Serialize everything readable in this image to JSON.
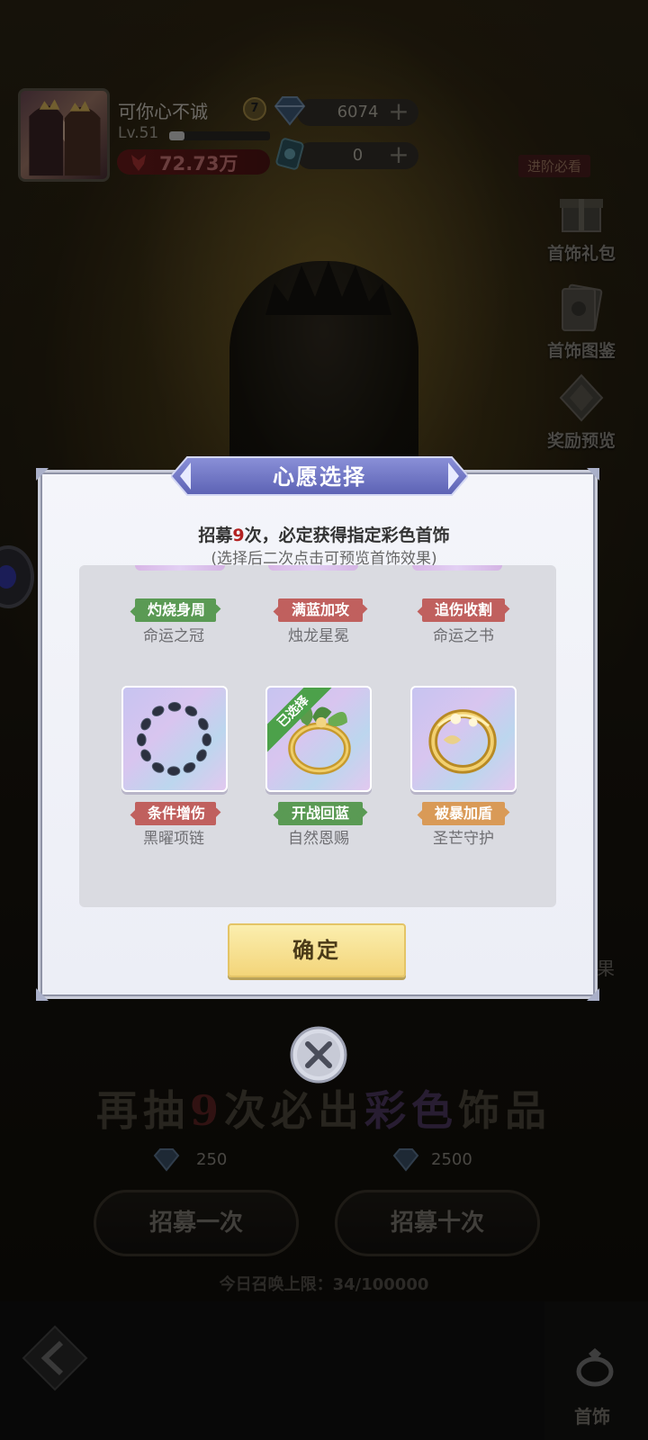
{
  "player": {
    "name": "可你心不诚",
    "level": "Lv.51",
    "level_progress": 0.15,
    "vip": "7",
    "power": "72.73万"
  },
  "currency": {
    "diamond": "6074",
    "ticket": "0",
    "plus": "+"
  },
  "side_menu": {
    "tag": "进阶必看",
    "items": [
      "首饰礼包",
      "首饰图鉴",
      "奖励预览"
    ]
  },
  "dialog": {
    "title": "心愿选择",
    "line1_prefix": "招募",
    "line1_count": "9",
    "line1_suffix": "次，必定获得指定彩色首饰",
    "line2": "(选择后二次点击可预览首饰效果)",
    "row1": [
      {
        "tag": "灼烧身周",
        "name": "命运之冠",
        "tag_color": "green"
      },
      {
        "tag": "满蓝加攻",
        "name": "烛龙星冕",
        "tag_color": "red"
      },
      {
        "tag": "追伤收割",
        "name": "命运之书",
        "tag_color": "red"
      }
    ],
    "row2": [
      {
        "tag": "条件增伤",
        "name": "黑曜项链",
        "tag_color": "red",
        "icon": "necklace-icon"
      },
      {
        "tag": "开战回蓝",
        "name": "自然恩赐",
        "tag_color": "green",
        "icon": "ring-leaf-icon",
        "selected": true
      },
      {
        "tag": "被暴加盾",
        "name": "圣芒守护",
        "tag_color": "orange",
        "icon": "ring-gold-icon"
      }
    ],
    "selected_label": "已选择",
    "confirm": "确定"
  },
  "banner": {
    "prefix": "再抽",
    "num": "9",
    "mid": "次必出",
    "colorful": "彩色",
    "suffix": "饰品"
  },
  "recruit": {
    "one": {
      "label": "招募一次",
      "price": "250"
    },
    "ten": {
      "label": "招募十次",
      "price": "2500"
    }
  },
  "daily_limit": "今日召唤上限：34/100000",
  "edge_text": "果",
  "bottom_nav": {
    "active_label": "首饰"
  },
  "colors": {
    "accent_red": "#b32222",
    "tag_green": "#5a9a54",
    "tag_red": "#c0605e",
    "tag_orange": "#d99a57",
    "confirm_gold": "#f3d57a"
  }
}
